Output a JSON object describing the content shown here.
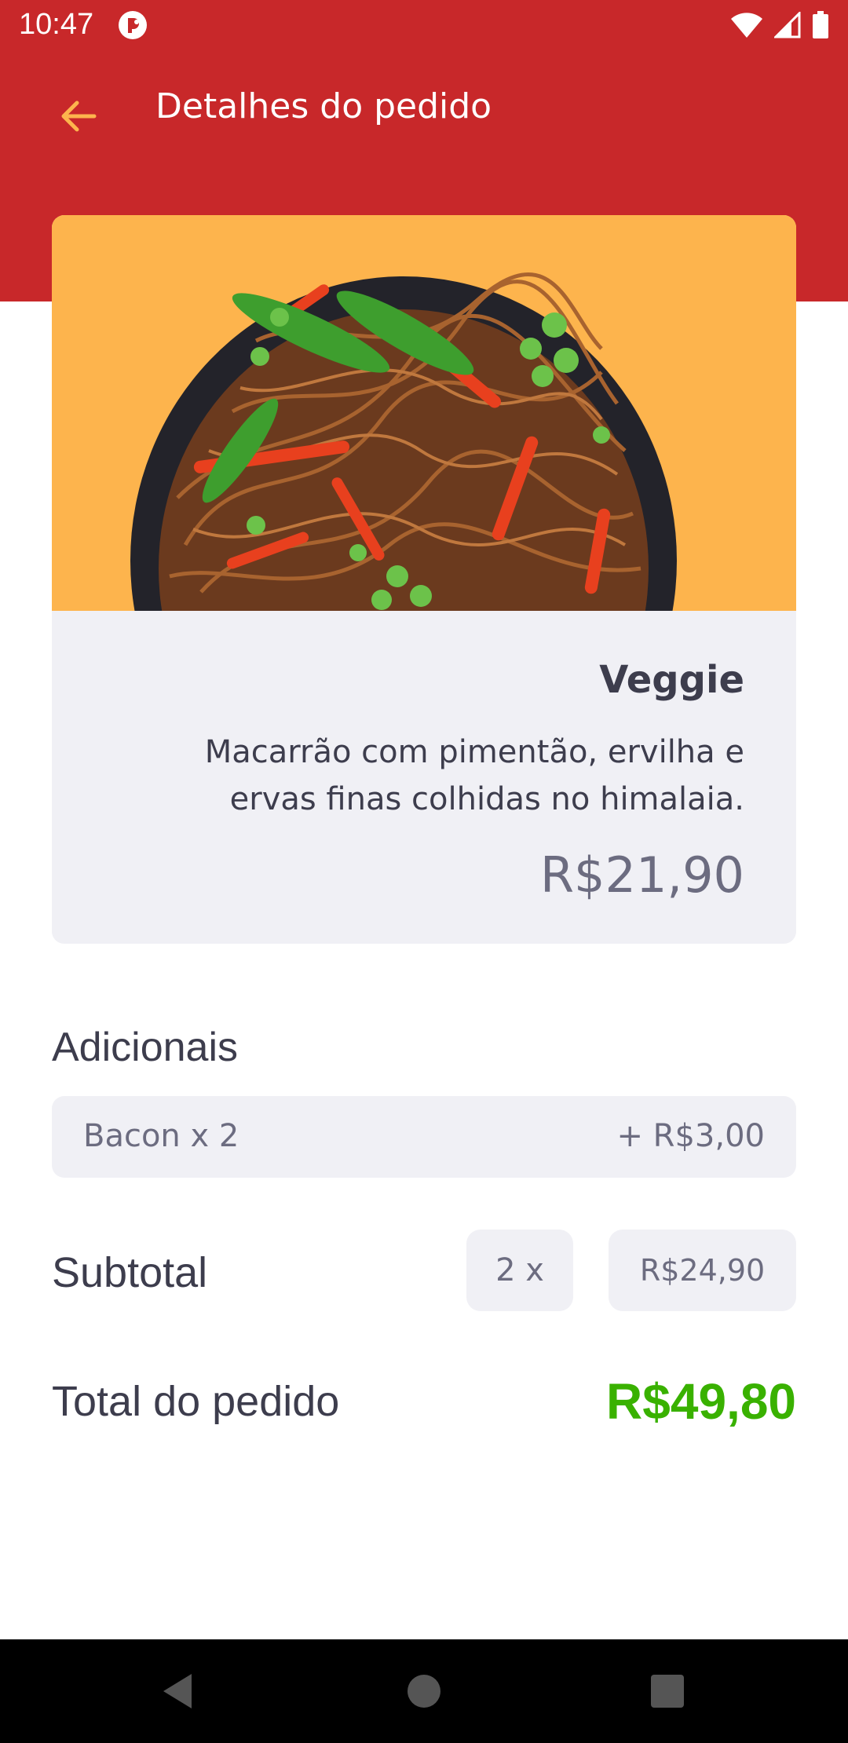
{
  "status_bar": {
    "time": "10:47"
  },
  "app_bar": {
    "title": "Detalhes do pedido"
  },
  "dish": {
    "name": "Veggie",
    "description": "Macarrão com pimentão, ervilha e ervas finas colhidas no himalaia.",
    "price": "R$21,90"
  },
  "extras": {
    "title": "Adicionais",
    "items": [
      {
        "name": "Bacon x 2",
        "price": "+ R$3,00"
      }
    ]
  },
  "subtotal": {
    "label": "Subtotal",
    "quantity": "2 x",
    "value": "R$24,90"
  },
  "total": {
    "label": "Total do pedido",
    "value": "R$49,80"
  },
  "colors": {
    "header": "#C8282A",
    "photo_background": "#FDB44D",
    "card_background": "#F0F0F5",
    "total_green": "#39B100",
    "back_arrow": "#FDB44D"
  }
}
